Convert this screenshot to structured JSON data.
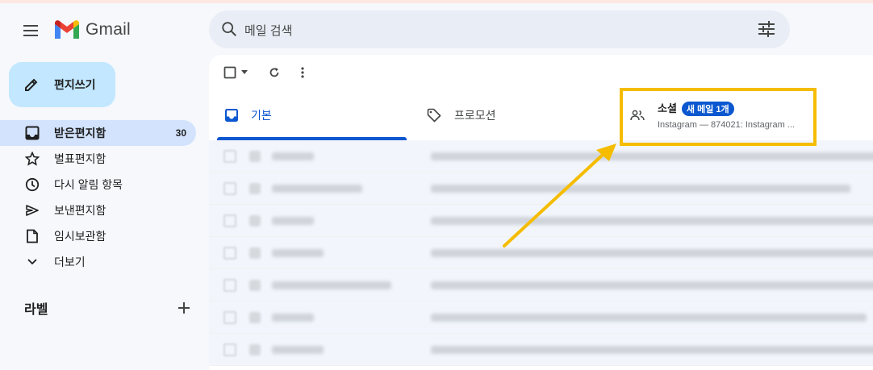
{
  "header": {
    "app_name": "Gmail",
    "search_placeholder": "메일 검색"
  },
  "sidebar": {
    "compose_label": "편지쓰기",
    "items": [
      {
        "label": "받은편지함",
        "count": "30",
        "icon": "inbox-icon",
        "active": true
      },
      {
        "label": "별표편지함",
        "count": "",
        "icon": "star-icon"
      },
      {
        "label": "다시 알림 항목",
        "count": "",
        "icon": "clock-icon"
      },
      {
        "label": "보낸편지함",
        "count": "",
        "icon": "send-icon"
      },
      {
        "label": "임시보관함",
        "count": "",
        "icon": "draft-icon"
      },
      {
        "label": "더보기",
        "count": "",
        "icon": "chevron-down-icon"
      }
    ],
    "labels_title": "라벨"
  },
  "tabs": {
    "primary": "기본",
    "promotions": "프로모션",
    "social": {
      "label": "소셜",
      "badge": "새 메일 1개",
      "preview": "Instagram — 874021: Instagram ..."
    }
  },
  "colors": {
    "accent": "#0b57d0",
    "highlight_box": "#f5bc00",
    "compose_bg": "#c2e7ff",
    "active_nav_bg": "#d3e3fd"
  }
}
